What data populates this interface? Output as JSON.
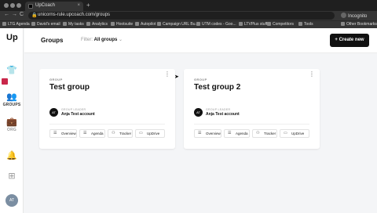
{
  "browser": {
    "tab_title": "UpCoach",
    "tab_close": "×",
    "new_tab": "+",
    "url": "unicorns-rule.upcoach.com/groups",
    "incognito_label": "Incognito",
    "nav": {
      "back": "←",
      "forward": "→",
      "reload": "C"
    },
    "bookmarks": [
      "LTG Agenda",
      "David's email",
      "My tasks",
      "Analytics",
      "Hootsuite",
      "Autopilot",
      "Campaign URL Bu...",
      "UTM codes - Goo...",
      "LTVPlus stuff",
      "Competitors",
      "Tools",
      "Other Bookmarks"
    ]
  },
  "sidebar": {
    "logo": "Up",
    "items": [
      {
        "label": "",
        "icon": "shirt-icon"
      },
      {
        "label": "GROUPS",
        "icon": "groups-icon"
      },
      {
        "label": "ORG",
        "icon": "briefcase-icon"
      },
      {
        "label": "",
        "icon": "bell-icon"
      },
      {
        "label": "",
        "icon": "plus-square-icon"
      }
    ],
    "avatar": "AT"
  },
  "header": {
    "title": "Groups",
    "filter_label": "Filter:",
    "filter_value": "All groups",
    "create_button": "+ Create new"
  },
  "groups": [
    {
      "eyebrow": "GROUP",
      "name": "Test group",
      "leader_role": "GROUP LEADER",
      "leader_initials": "AT",
      "leader_name": "Anja Test account",
      "actions": [
        {
          "label": "Overview",
          "icon": "list-icon"
        },
        {
          "label": "Agenda",
          "icon": "list-icon"
        },
        {
          "label": "Tracker",
          "icon": "people-icon"
        },
        {
          "label": "UpDrive",
          "icon": "folder-icon"
        }
      ]
    },
    {
      "eyebrow": "GROUP",
      "name": "Test group 2",
      "leader_role": "GROUP LEADER",
      "leader_initials": "AT",
      "leader_name": "Anja Test account",
      "actions": [
        {
          "label": "Overview",
          "icon": "list-icon"
        },
        {
          "label": "Agenda",
          "icon": "list-icon"
        },
        {
          "label": "Tracker",
          "icon": "people-icon"
        },
        {
          "label": "UpDrive",
          "icon": "folder-icon"
        }
      ]
    }
  ],
  "colors": {
    "accent": "#111111",
    "sidebar_marker": "#c9274a",
    "avatar": "#7b8ea2"
  }
}
